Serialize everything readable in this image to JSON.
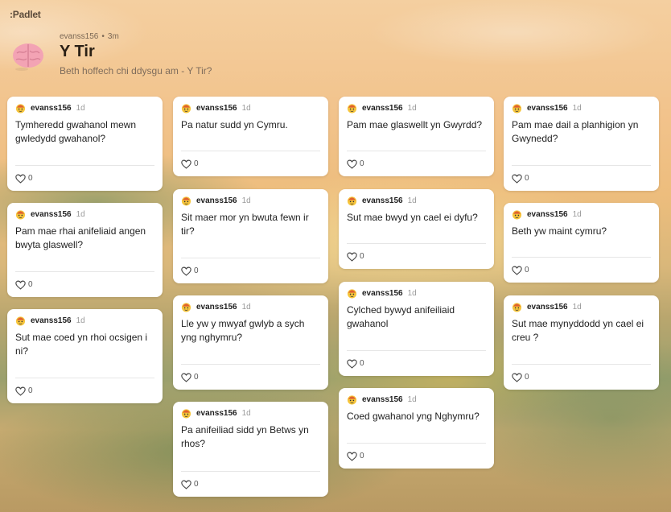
{
  "app": {
    "brand": ":Padlet"
  },
  "header": {
    "author": "evanss156",
    "age": "3m",
    "title": "Y Tir",
    "subtitle": "Beth hoffech chi ddysgu am - Y Tir?"
  },
  "columns": [
    [
      {
        "author": "evanss156",
        "time": "1d",
        "text": "Tymheredd gwahanol mewn gwledydd gwahanol?",
        "likes": "0"
      },
      {
        "author": "evanss156",
        "time": "1d",
        "text": "Pam mae rhai anifeliaid angen bwyta glaswell?",
        "likes": "0"
      },
      {
        "author": "evanss156",
        "time": "1d",
        "text": "Sut mae coed yn rhoi ocsigen i ni?",
        "likes": "0"
      }
    ],
    [
      {
        "author": "evanss156",
        "time": "1d",
        "text": "Pa natur sudd yn Cymru.",
        "likes": "0"
      },
      {
        "author": "evanss156",
        "time": "1d",
        "text": "Sit maer mor yn bwuta fewn ir tir?",
        "likes": "0"
      },
      {
        "author": "evanss156",
        "time": "1d",
        "text": "Lle yw y mwyaf gwlyb a sych yng nghymru?",
        "likes": "0"
      },
      {
        "author": "evanss156",
        "time": "1d",
        "text": "Pa anifeiliad sidd yn Betws yn rhos?",
        "likes": "0"
      }
    ],
    [
      {
        "author": "evanss156",
        "time": "1d",
        "text": "Pam mae glaswellt yn Gwyrdd?",
        "likes": "0"
      },
      {
        "author": "evanss156",
        "time": "1d",
        "text": "Sut mae bwyd yn cael ei dyfu?",
        "likes": "0"
      },
      {
        "author": "evanss156",
        "time": "1d",
        "text": "Cylched bywyd anifeiliaid gwahanol",
        "likes": "0"
      },
      {
        "author": "evanss156",
        "time": "1d",
        "text": "Coed gwahanol yng Nghymru?",
        "likes": "0"
      }
    ],
    [
      {
        "author": "evanss156",
        "time": "1d",
        "text": "Pam mae dail a planhigion yn Gwynedd?",
        "likes": "0"
      },
      {
        "author": "evanss156",
        "time": "1d",
        "text": "Beth yw maint cymru?",
        "likes": "0"
      },
      {
        "author": "evanss156",
        "time": "1d",
        "text": "Sut mae mynyddodd yn cael ei creu ?",
        "likes": "0"
      }
    ]
  ]
}
